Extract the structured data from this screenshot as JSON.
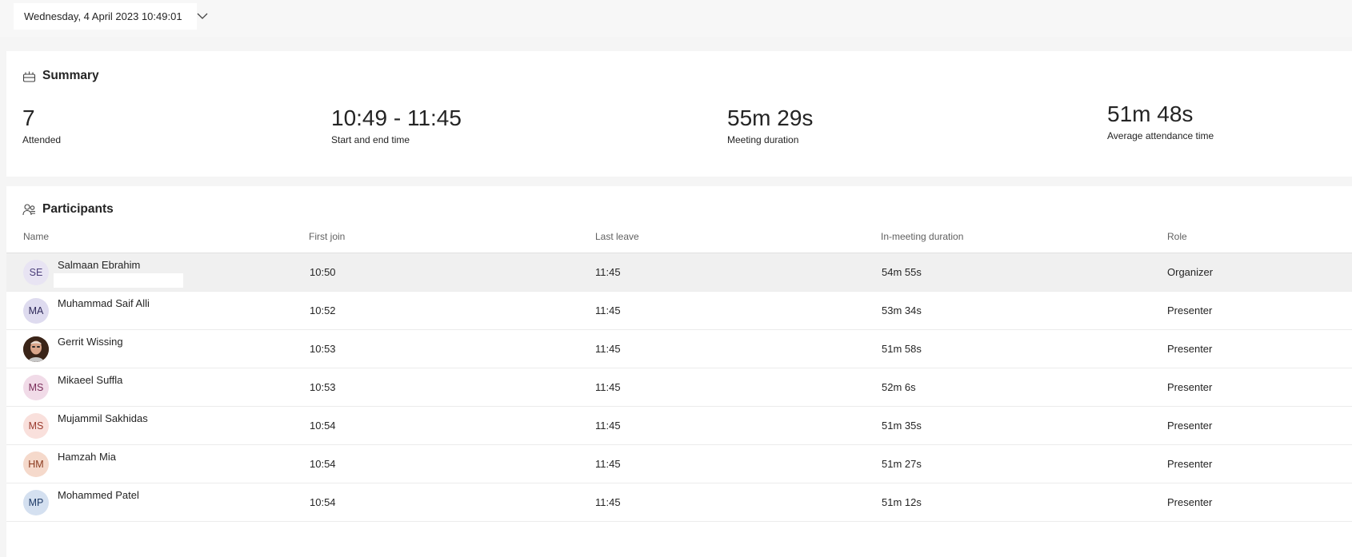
{
  "date_selector": {
    "value": "Wednesday, 4 April 2023 10:49:01",
    "chevron_icon": "chevron-down-icon"
  },
  "summary": {
    "title": "Summary",
    "icon": "summary-icon",
    "stats": [
      {
        "value": "7",
        "label": "Attended"
      },
      {
        "value": "10:49 - 11:45",
        "label": "Start and end time"
      },
      {
        "value": "55m 29s",
        "label": "Meeting duration"
      },
      {
        "value": "51m 48s",
        "label": "Average attendance time"
      }
    ]
  },
  "participants": {
    "title": "Participants",
    "icon": "people-icon",
    "columns": [
      "Name",
      "First join",
      "Last leave",
      "In-meeting duration",
      "Role"
    ],
    "rows": [
      {
        "initials": "SE",
        "name": "Salmaan Ebrahim",
        "first_join": "10:50",
        "last_leave": "11:45",
        "duration": "54m 55s",
        "role": "Organizer",
        "avatar_bg": "#e8e4f3",
        "avatar_fg": "#4b3f7a"
      },
      {
        "initials": "MA",
        "name": "Muhammad Saif Alli",
        "first_join": "10:52",
        "last_leave": "11:45",
        "duration": "53m 34s",
        "role": "Presenter",
        "avatar_bg": "#dedbef",
        "avatar_fg": "#2f2a5a"
      },
      {
        "initials": "",
        "name": "Gerrit Wissing",
        "first_join": "10:53",
        "last_leave": "11:45",
        "duration": "51m 58s",
        "role": "Presenter",
        "avatar_bg": "#5a3a2a",
        "avatar_fg": "#ffffff"
      },
      {
        "initials": "MS",
        "name": "Mikaeel Suffla",
        "first_join": "10:53",
        "last_leave": "11:45",
        "duration": "52m 6s",
        "role": "Presenter",
        "avatar_bg": "#f1dbe8",
        "avatar_fg": "#7a2e5a"
      },
      {
        "initials": "MS",
        "name": "Mujammil Sakhidas",
        "first_join": "10:54",
        "last_leave": "11:45",
        "duration": "51m 35s",
        "role": "Presenter",
        "avatar_bg": "#f9e0dc",
        "avatar_fg": "#9a3a2e"
      },
      {
        "initials": "HM",
        "name": "Hamzah Mia",
        "first_join": "10:54",
        "last_leave": "11:45",
        "duration": "51m 27s",
        "role": "Presenter",
        "avatar_bg": "#f5d9cb",
        "avatar_fg": "#8a3a1e"
      },
      {
        "initials": "MP",
        "name": "Mohammed Patel",
        "first_join": "10:54",
        "last_leave": "11:45",
        "duration": "51m 12s",
        "role": "Presenter",
        "avatar_bg": "#d4e0f0",
        "avatar_fg": "#1f3a66"
      }
    ]
  }
}
